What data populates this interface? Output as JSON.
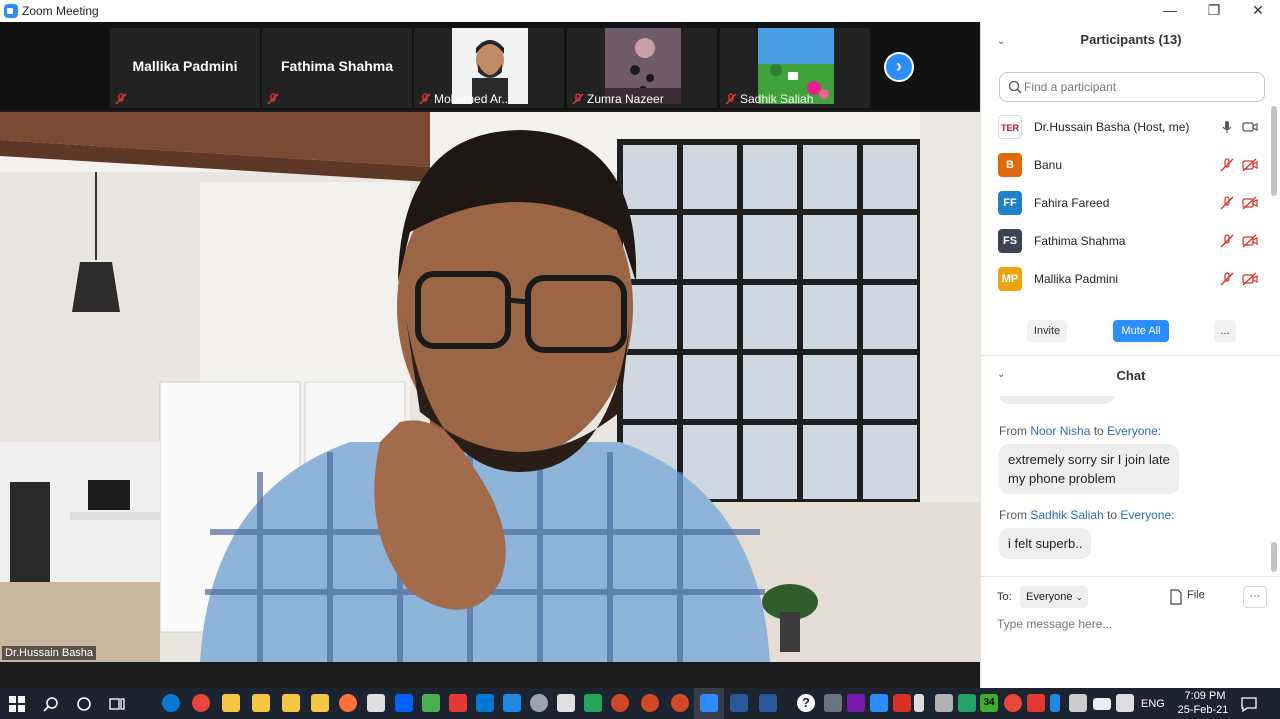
{
  "window": {
    "title": "Zoom Meeting",
    "minimize": "—",
    "maximize": "❐",
    "close": "✕"
  },
  "gallery": {
    "tiles": [
      {
        "name": "Mallika Padmini",
        "style": "name"
      },
      {
        "name": "Fathima Shahma",
        "style": "name"
      },
      {
        "name": "Mohamed Ar...",
        "style": "photo"
      },
      {
        "name": "Zumra Nazeer",
        "style": "photo"
      },
      {
        "name": "Sadhik Saliah",
        "style": "photo"
      }
    ],
    "next": "›"
  },
  "main_video": {
    "speaker": "Dr.Hussain Basha"
  },
  "participants": {
    "title": "Participants (13)",
    "collapse": "⌄",
    "search_placeholder": "Find a participant",
    "list": [
      {
        "initials": "TER",
        "name": "Dr.Hussain Basha (Host, me)",
        "color": "#c8102e",
        "muted": false
      },
      {
        "initials": "B",
        "name": "Banu",
        "color": "#e0690a",
        "muted": true
      },
      {
        "initials": "FF",
        "name": "Fahira Fareed",
        "color": "#1f80c8",
        "muted": true
      },
      {
        "initials": "FS",
        "name": "Fathima Shahma",
        "color": "#3a4454",
        "muted": true
      },
      {
        "initials": "MP",
        "name": "Mallika Padmini",
        "color": "#f0a30a",
        "muted": true
      }
    ],
    "invite": "Invite",
    "mute_all": "Mute All",
    "more": "..."
  },
  "chat": {
    "title": "Chat",
    "collapse": "⌄",
    "messages": [
      {
        "from_prefix": "From ",
        "from": "Noor Nisha",
        "to_prefix": " to ",
        "to": "Everyone:",
        "line1": "extremely  sorry sir I join late",
        "line2": "my phone problem"
      },
      {
        "from_prefix": "From ",
        "from": "Sadhik Saliah",
        "to_prefix": " to ",
        "to": "Everyone:",
        "line1": "i felt superb.."
      }
    ],
    "to_label": "To:",
    "to_value": "Everyone",
    "file_label": "File",
    "more": "···",
    "input_placeholder": "Type message here..."
  },
  "taskbar": {
    "time": "7:09 PM",
    "date": "25-Feb-21",
    "language": "ENG",
    "badge": "34"
  },
  "colors": {
    "accent": "#2d8cff",
    "dark": "#1a1a1a",
    "taskbar": "#1c2430",
    "muted_red": "#d93025"
  }
}
